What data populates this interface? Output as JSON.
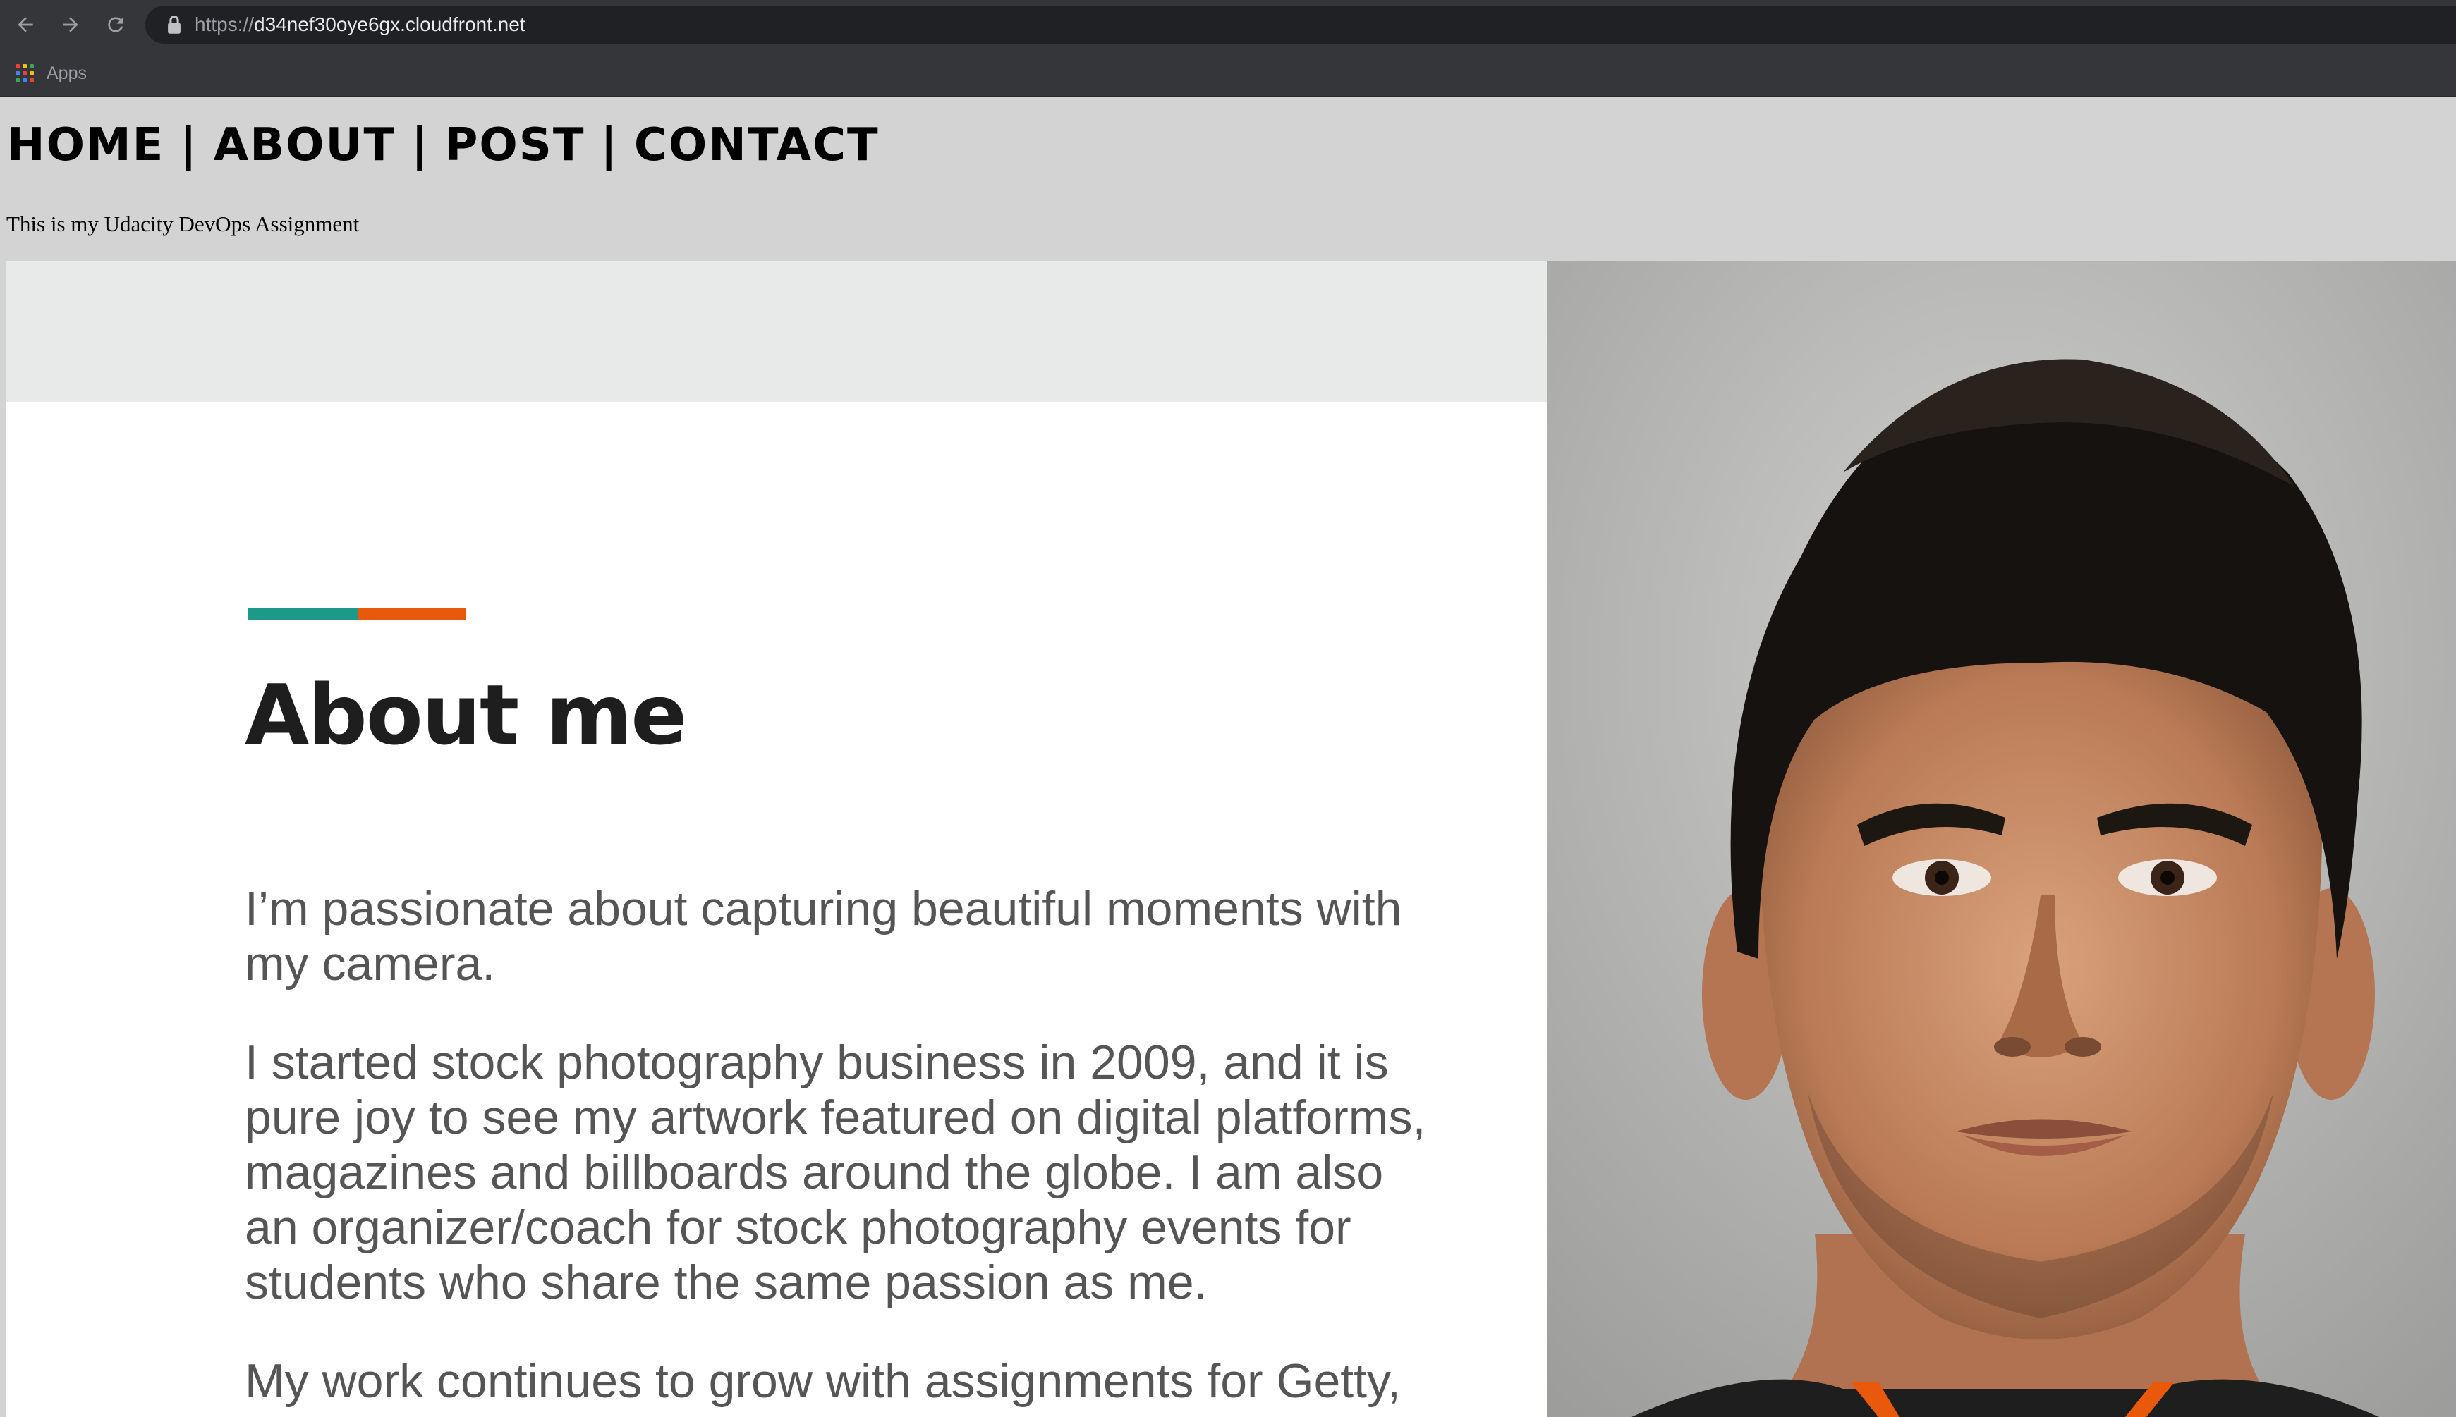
{
  "browser": {
    "url_scheme": "https://",
    "url_host": "d34nef30oye6gx.cloudfront.net",
    "bookmarks": [
      {
        "label": "Apps",
        "icon": "apps-grid-icon"
      }
    ],
    "icons": {
      "back": "back-arrow-icon",
      "forward": "forward-arrow-icon",
      "reload": "reload-icon",
      "lock": "lock-icon"
    },
    "apps_icon_colors": [
      "#ea4335",
      "#fbbc04",
      "#34a853",
      "#4285f4",
      "#ea4335",
      "#fbbc04",
      "#34a853",
      "#4285f4",
      "#ea4335"
    ]
  },
  "site": {
    "nav": [
      {
        "label": "HOME"
      },
      {
        "label": "ABOUT"
      },
      {
        "label": "POST"
      },
      {
        "label": "CONTACT"
      }
    ],
    "nav_separator": "|",
    "tagline": "This is my Udacity DevOps Assignment"
  },
  "about": {
    "heading": "About me",
    "paragraphs": [
      "I’m passionate about capturing beautiful moments with my camera.",
      "I started stock photography business in 2009, and it is pure joy to see my artwork featured on digital platforms, magazines and billboards around the globe. I am also an organizer/coach for stock photography events for students who share the same passion as me.",
      "My work continues to grow with assignments for Getty,"
    ],
    "accent_colors": {
      "teal": "#1b9a8a",
      "orange": "#e8590c"
    }
  },
  "portrait": {
    "subject": "portrait-photo"
  }
}
